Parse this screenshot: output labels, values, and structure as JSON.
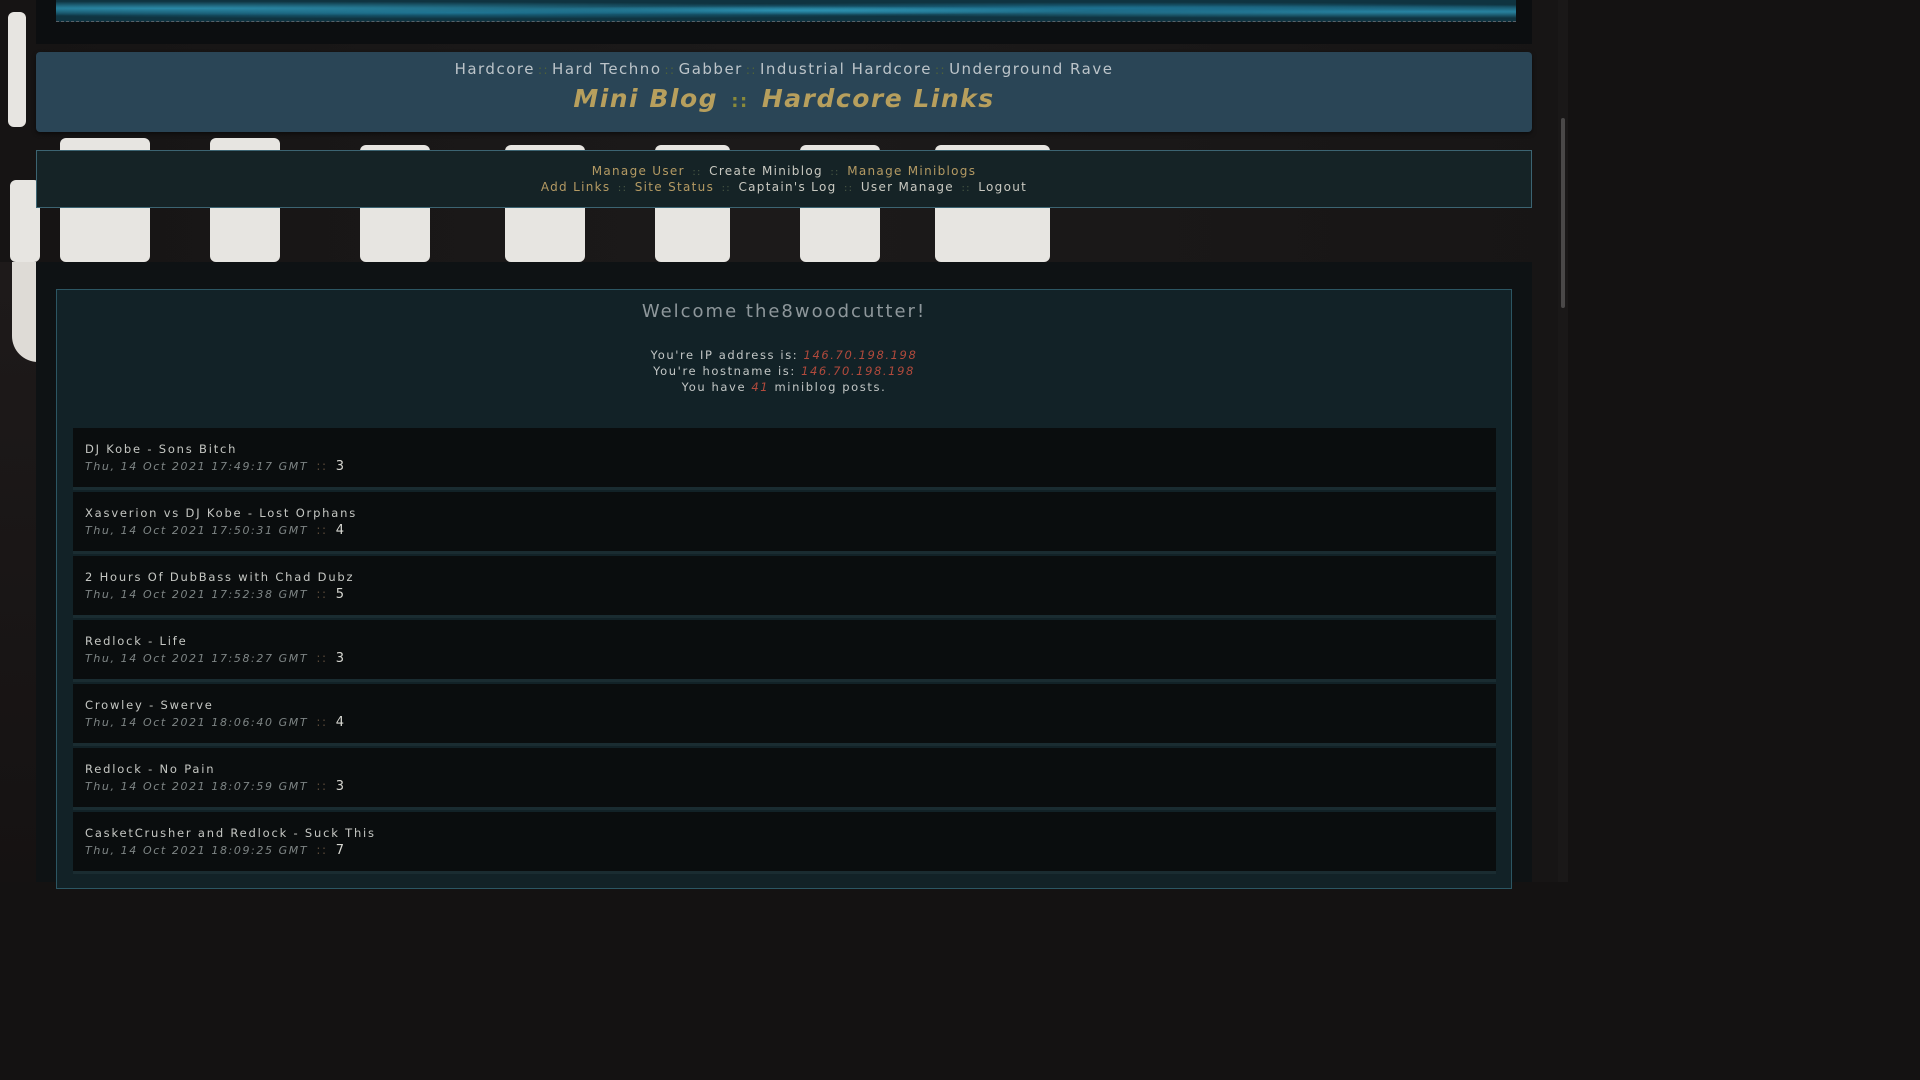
{
  "genre_nav": {
    "items": [
      "Hardcore",
      "Hard Techno",
      "Gabber",
      "Industrial Hardcore",
      "Underground Rave"
    ],
    "separator": "::"
  },
  "site_title": {
    "part1": "Mini Blog",
    "separator": "::",
    "part2": "Hardcore Links"
  },
  "admin_nav": {
    "row1": [
      "Manage User",
      "Create Miniblog",
      "Manage Miniblogs"
    ],
    "row2": [
      "Add Links",
      "Site Status",
      "Captain's Log",
      "User Manage",
      "Logout"
    ],
    "separator": "::"
  },
  "welcome": {
    "heading": "Welcome the8woodcutter!",
    "ip_label": "You're IP address is:",
    "ip_value": "146.70.198.198",
    "host_label": "You're hostname is:",
    "host_value": "146.70.198.198",
    "posts_prefix": "You have",
    "posts_count": "41",
    "posts_suffix": "miniblog posts."
  },
  "posts": [
    {
      "title": "DJ Kobe - Sons Bitch",
      "date": "Thu, 14 Oct 2021 17:49:17 GMT",
      "count": "3"
    },
    {
      "title": "Xasverion vs DJ Kobe - Lost Orphans",
      "date": "Thu, 14 Oct 2021 17:50:31 GMT",
      "count": "4"
    },
    {
      "title": "2 Hours Of DubBass with Chad Dubz",
      "date": "Thu, 14 Oct 2021 17:52:38 GMT",
      "count": "5"
    },
    {
      "title": "Redlock - Life",
      "date": "Thu, 14 Oct 2021 17:58:27 GMT",
      "count": "3"
    },
    {
      "title": "Crowley - Swerve",
      "date": "Thu, 14 Oct 2021 18:06:40 GMT",
      "count": "4"
    },
    {
      "title": "Redlock - No Pain",
      "date": "Thu, 14 Oct 2021 18:07:59 GMT",
      "count": "3"
    },
    {
      "title": "CasketCrusher and Redlock - Suck This",
      "date": "Thu, 14 Oct 2021 18:09:25 GMT",
      "count": "7"
    }
  ],
  "colors": {
    "gold": "#b79f5d",
    "accent_red": "#b24a3c",
    "panel_blue": "#2a4556",
    "panel_border": "#3c6472"
  }
}
